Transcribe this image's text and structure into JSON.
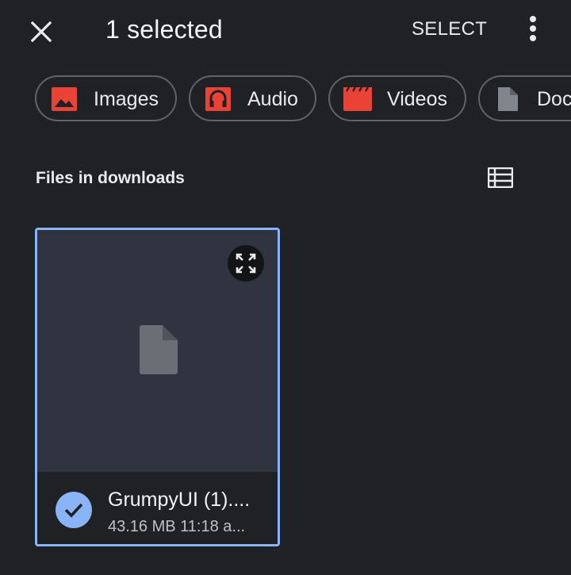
{
  "header": {
    "title": "1 selected",
    "select_label": "SELECT"
  },
  "chips": [
    {
      "label": "Images",
      "icon": "image-icon",
      "color": "#ea4335"
    },
    {
      "label": "Audio",
      "icon": "headphones-icon",
      "color": "#ea4335"
    },
    {
      "label": "Videos",
      "icon": "clapperboard-icon",
      "color": "#ea4335"
    },
    {
      "label": "Doc",
      "icon": "document-icon",
      "color": "#80868b"
    }
  ],
  "section": {
    "title": "Files in downloads"
  },
  "files": [
    {
      "name": "GrumpyUI (1)....",
      "meta": "43.16 MB 11:18 a...",
      "selected": true
    }
  ],
  "colors": {
    "background": "#202124",
    "accent": "#8ab4f8",
    "card_preview": "#303440",
    "chip_border": "#5f6368"
  }
}
